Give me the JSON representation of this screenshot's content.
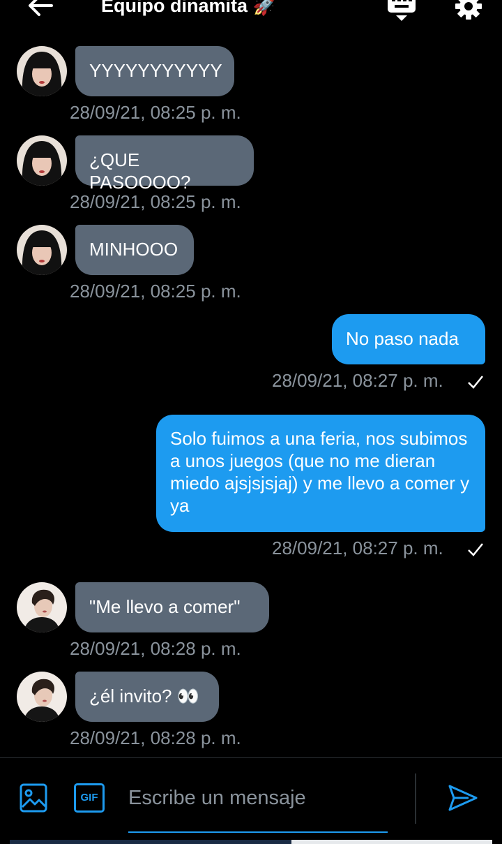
{
  "header": {
    "title": "Equipo dinamita 🚀"
  },
  "messages": [
    {
      "side": "in",
      "text": "YYYYYYYYYYY",
      "time": "28/09/21, 08:25 p. m.",
      "avatar": "avatar-girl"
    },
    {
      "side": "in",
      "text": "¿QUE PASOOOO?",
      "time": "28/09/21, 08:25 p. m.",
      "avatar": "avatar-girl"
    },
    {
      "side": "in",
      "text": "MINHOOO",
      "time": "28/09/21, 08:25 p. m.",
      "avatar": "avatar-girl"
    },
    {
      "side": "out",
      "text": "No paso nada",
      "time": "28/09/21, 08:27 p. m."
    },
    {
      "side": "out",
      "text": "Solo fuimos a una feria, nos subimos a unos juegos (que no me dieran miedo ajsjsjsjaj) y me llevo a comer y ya",
      "time": "28/09/21, 08:27 p. m."
    },
    {
      "side": "in",
      "text": "\"Me llevo a comer\"",
      "time": "28/09/21, 08:28 p. m.",
      "avatar": "avatar-boy"
    },
    {
      "side": "in",
      "text": "¿él invito? 👀",
      "time": "28/09/21, 08:28 p. m.",
      "avatar": "avatar-boy"
    }
  ],
  "composer": {
    "placeholder": "Escribe un mensaje",
    "gif_label": "GIF"
  },
  "colors": {
    "accent": "#1d9bf0",
    "incoming_bubble": "#5b6877",
    "timestamp": "#8a939c"
  }
}
